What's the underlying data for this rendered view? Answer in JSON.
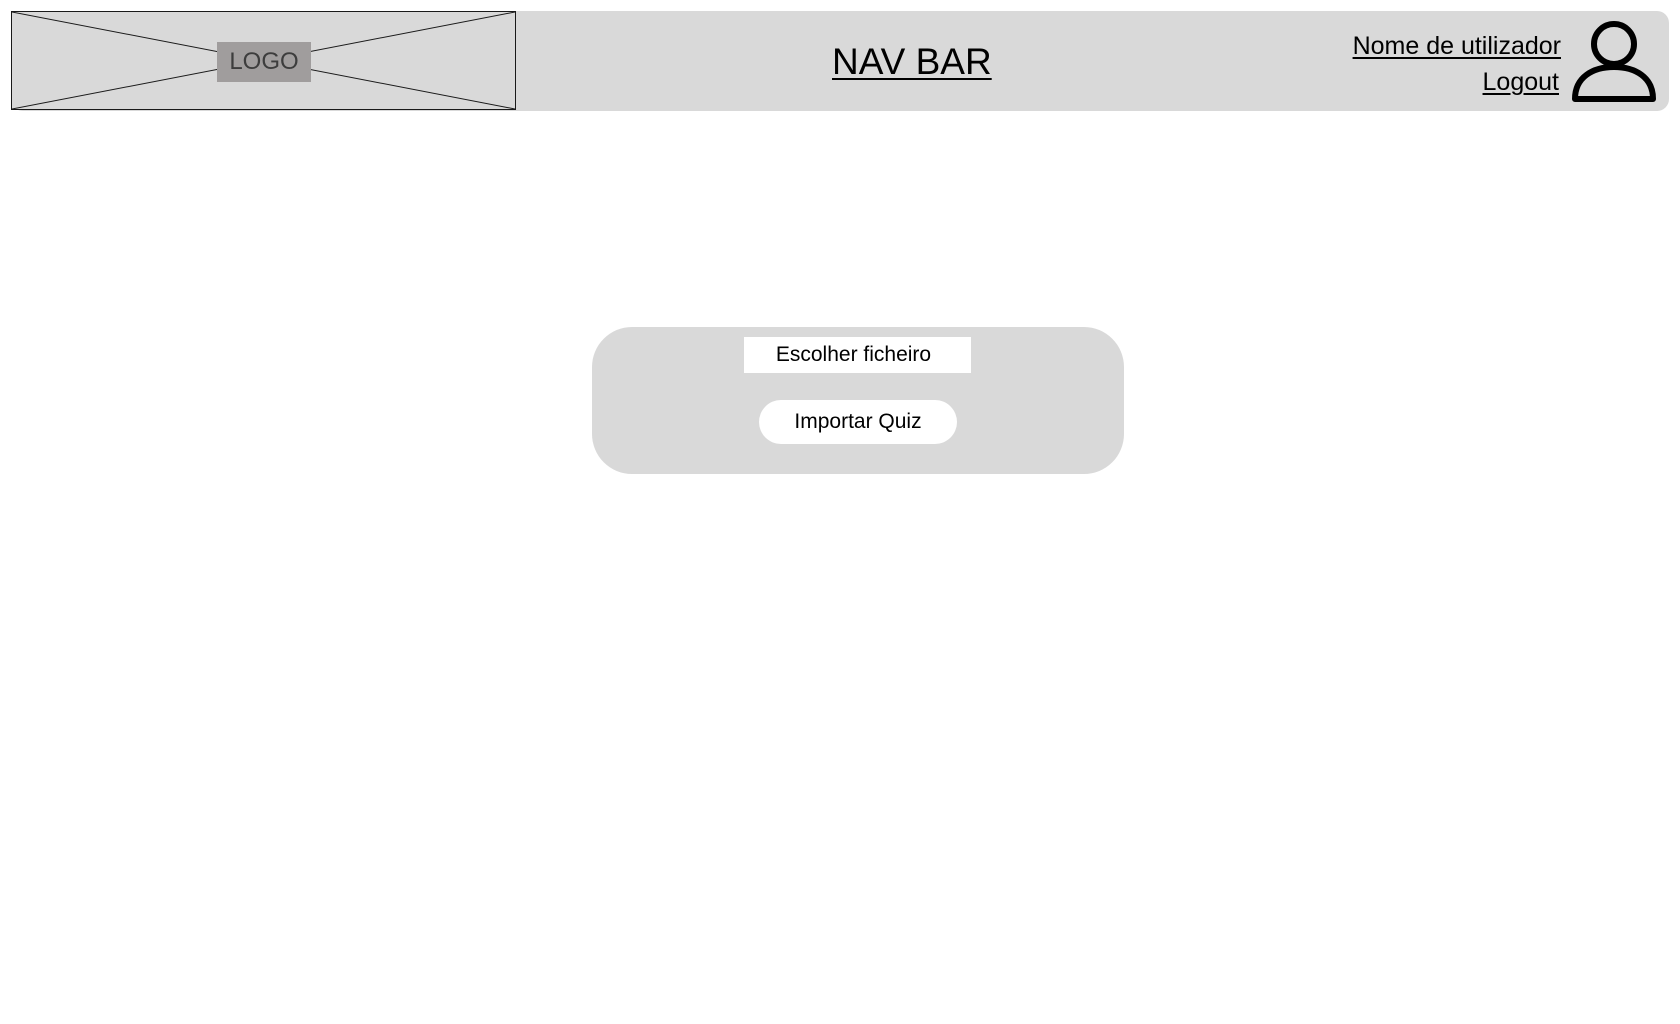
{
  "navbar": {
    "logo_label": "LOGO",
    "title": "NAV BAR",
    "user_name": "Nome de utilizador",
    "logout_label": "Logout",
    "avatar_icon": "user-icon",
    "background_color": "#d9d9d9"
  },
  "import_panel": {
    "file_button_label": "Escolher ficheiro",
    "import_button_label": "Importar Quiz",
    "background_color": "#d9d9d9"
  }
}
